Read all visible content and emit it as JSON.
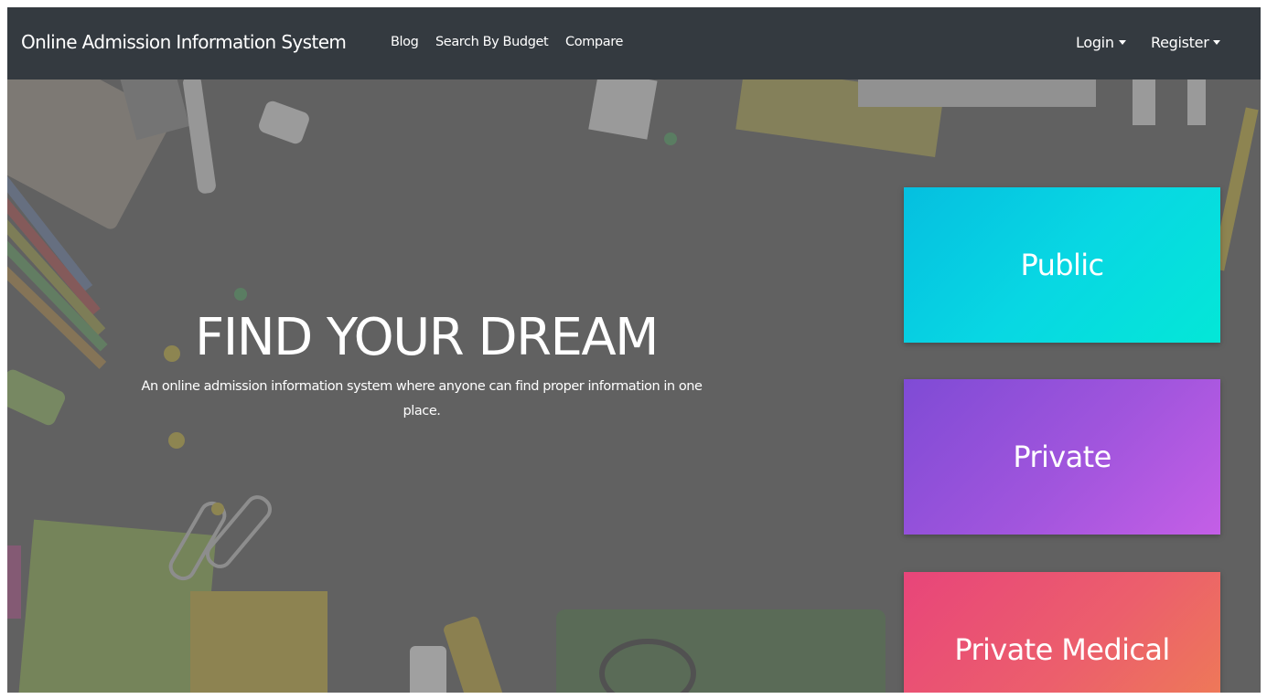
{
  "navbar": {
    "brand": "Online Admission Information System",
    "links": [
      {
        "label": "Blog"
      },
      {
        "label": "Search By Budget"
      },
      {
        "label": "Compare"
      }
    ],
    "login_label": "Login",
    "register_label": "Register",
    "background_color": "#343a40"
  },
  "hero": {
    "title": "FIND YOUR DREAM",
    "subtitle": "An online admission information system where anyone can find proper information in one place."
  },
  "categories": [
    {
      "label": "Public",
      "colors": [
        "#05bfe0",
        "#04e7d7"
      ]
    },
    {
      "label": "Private",
      "colors": [
        "#7f4bd5",
        "#c45fe6"
      ]
    },
    {
      "label": "Private Medical",
      "colors": [
        "#e8457a",
        "#ee7d55"
      ]
    }
  ]
}
